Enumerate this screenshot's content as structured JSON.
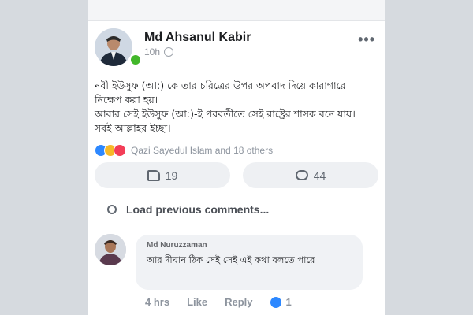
{
  "post": {
    "author": "Md Ahsanul Kabir",
    "time": "10h",
    "text_line1": "নবী ইউসুফ (আ:) কে তার চরিত্রের উপর অপবাদ দিয়ে কারাগারে নিক্ষেপ করা হয়।",
    "text_line2": "আবার সেই ইউসুফ (আ:)-ই পরবর্তীতে সেই রাষ্ট্রের শাসক বনে যায়। সবই আল্লাহর ইচ্ছা।",
    "reactions_text": "Qazi Sayedul Islam and 18 others",
    "like_count": "19",
    "comment_count": "44"
  },
  "comments": {
    "load_previous_label": "Load previous comments...",
    "items": [
      {
        "author": "Md Nuruzzaman",
        "text": "আর দীঘান ঠিক সেই সেই এই কথা বলতে পারে",
        "time": "4 hrs",
        "like_label": "Like",
        "reply_label": "Reply",
        "like_count": "1"
      }
    ]
  },
  "icons": {
    "more": "more-horizontal-icon",
    "privacy": "globe-icon",
    "like": "thumbs-up-icon",
    "comment": "comment-bubble-icon"
  },
  "colors": {
    "accent": "#2d88ff",
    "online": "#42b72a"
  }
}
